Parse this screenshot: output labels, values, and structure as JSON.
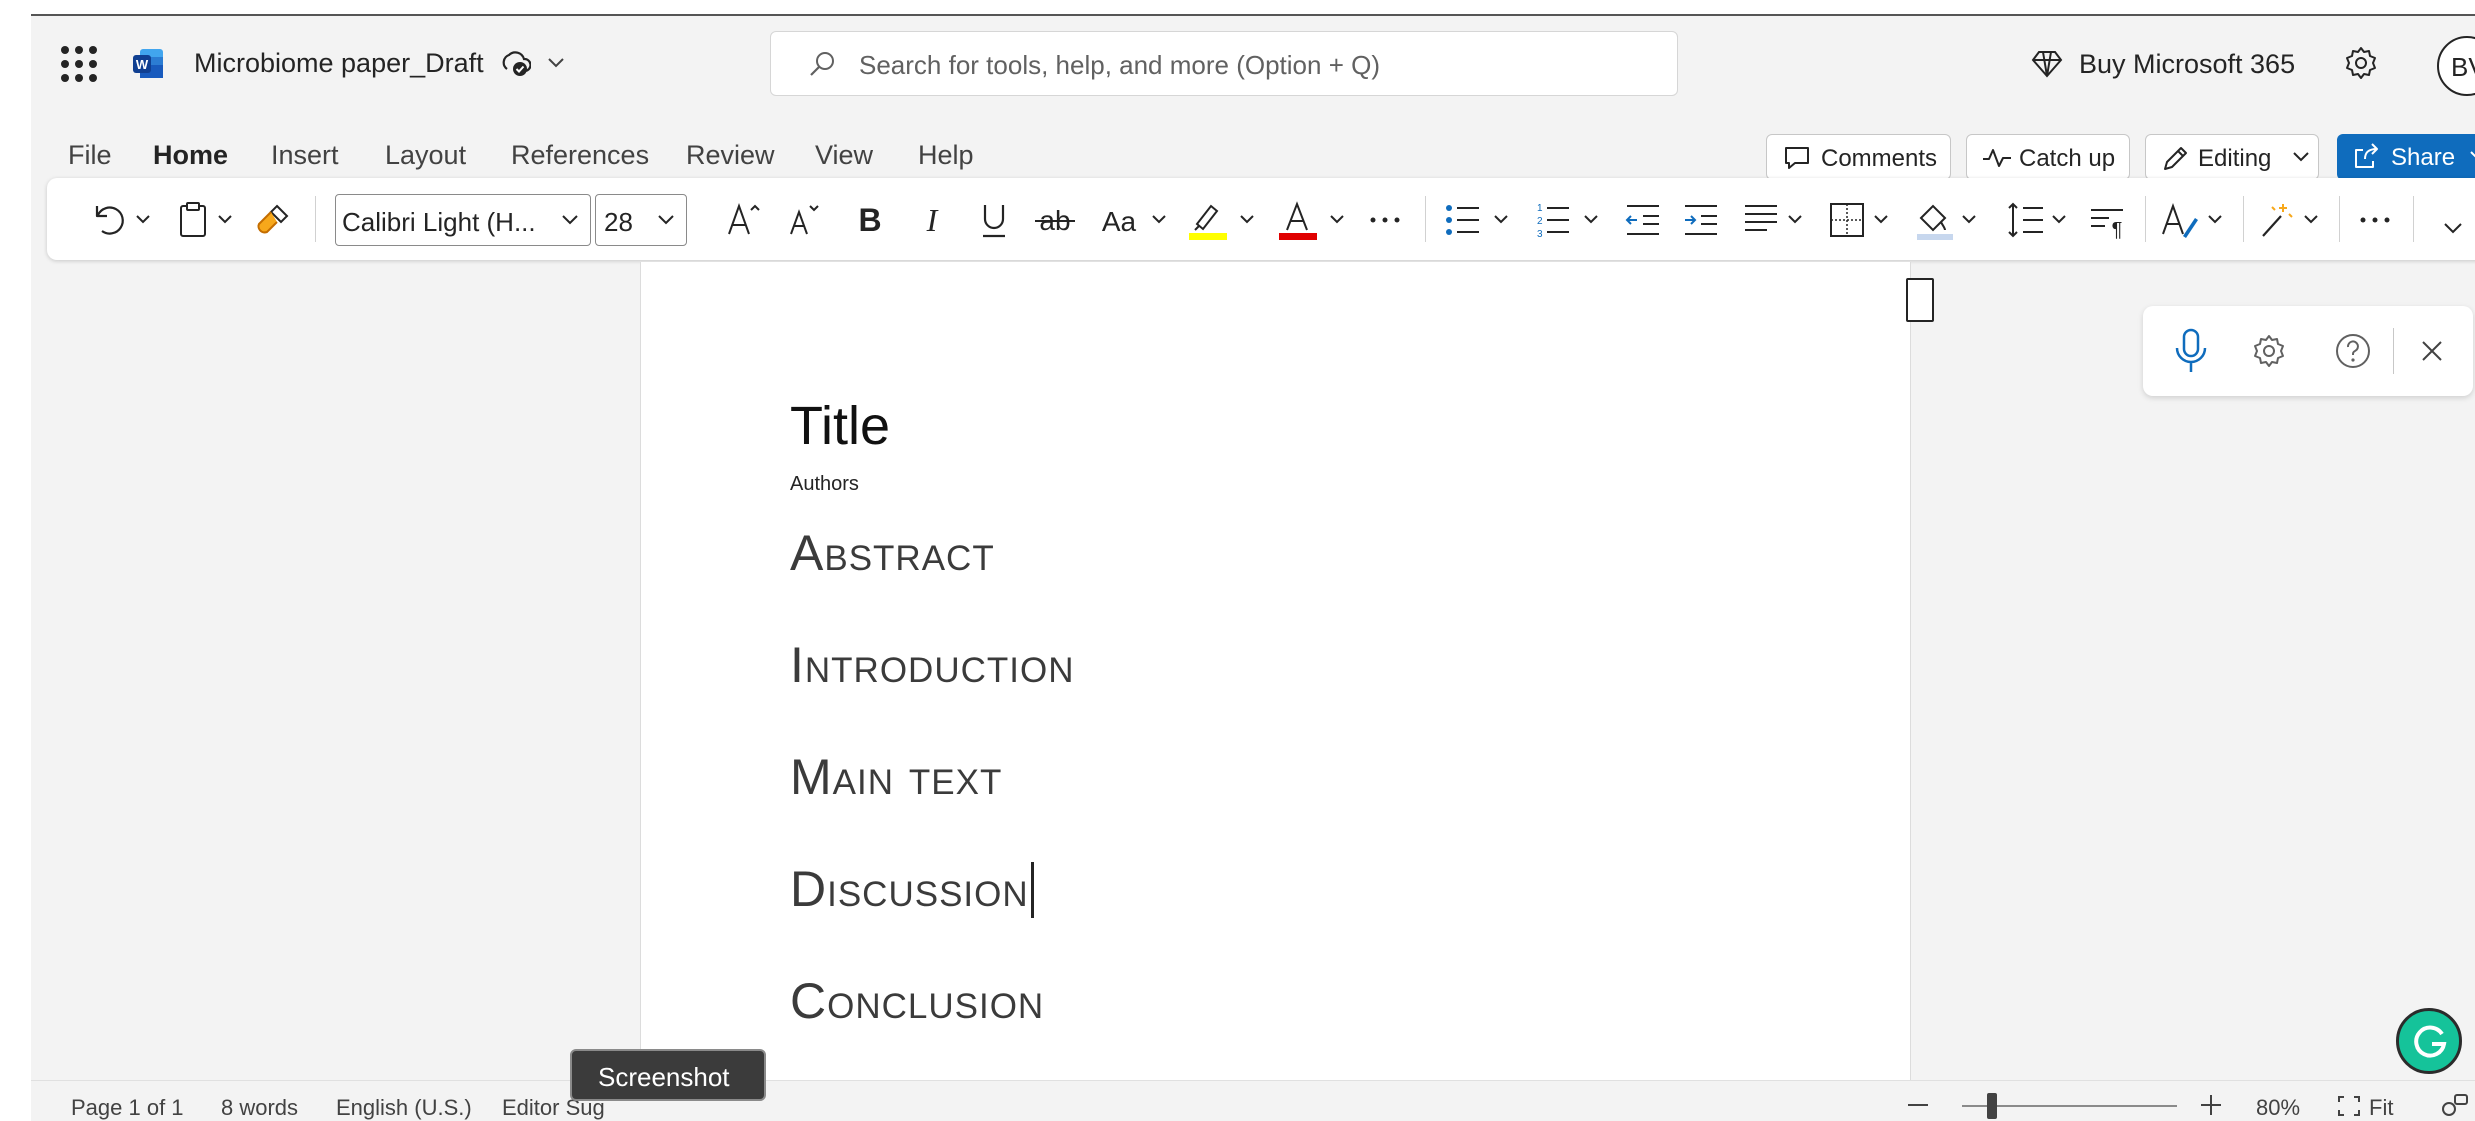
{
  "app": {
    "doc_title": "Microbiome paper_Draft",
    "search_placeholder": "Search for tools, help, and more (Option + Q)",
    "buy_label": "Buy Microsoft 365",
    "avatar_initials": "BV"
  },
  "menu": {
    "tabs": [
      "File",
      "Home",
      "Insert",
      "Layout",
      "References",
      "Review",
      "View",
      "Help"
    ],
    "active_tab": "Home",
    "comments_label": "Comments",
    "catchup_label": "Catch up",
    "editing_label": "Editing",
    "share_label": "Share"
  },
  "ribbon": {
    "font_name": "Calibri Light (H...",
    "font_size": "28",
    "highlight_color": "#ffff00",
    "font_color": "#e00000"
  },
  "document": {
    "title": "Title",
    "authors": "Authors",
    "headings": [
      "Abstract",
      "Introduction",
      "Main text",
      "Discussion",
      "Conclusion"
    ]
  },
  "status": {
    "page": "Page 1 of 1",
    "words": "8 words",
    "language": "English (U.S.)",
    "editor": "Editor Sug",
    "zoom": "80%",
    "fit": "Fit",
    "tooltip": "Screenshot"
  },
  "colors": {
    "accent": "#0f6cbd",
    "grammarly": "#15c39a"
  }
}
